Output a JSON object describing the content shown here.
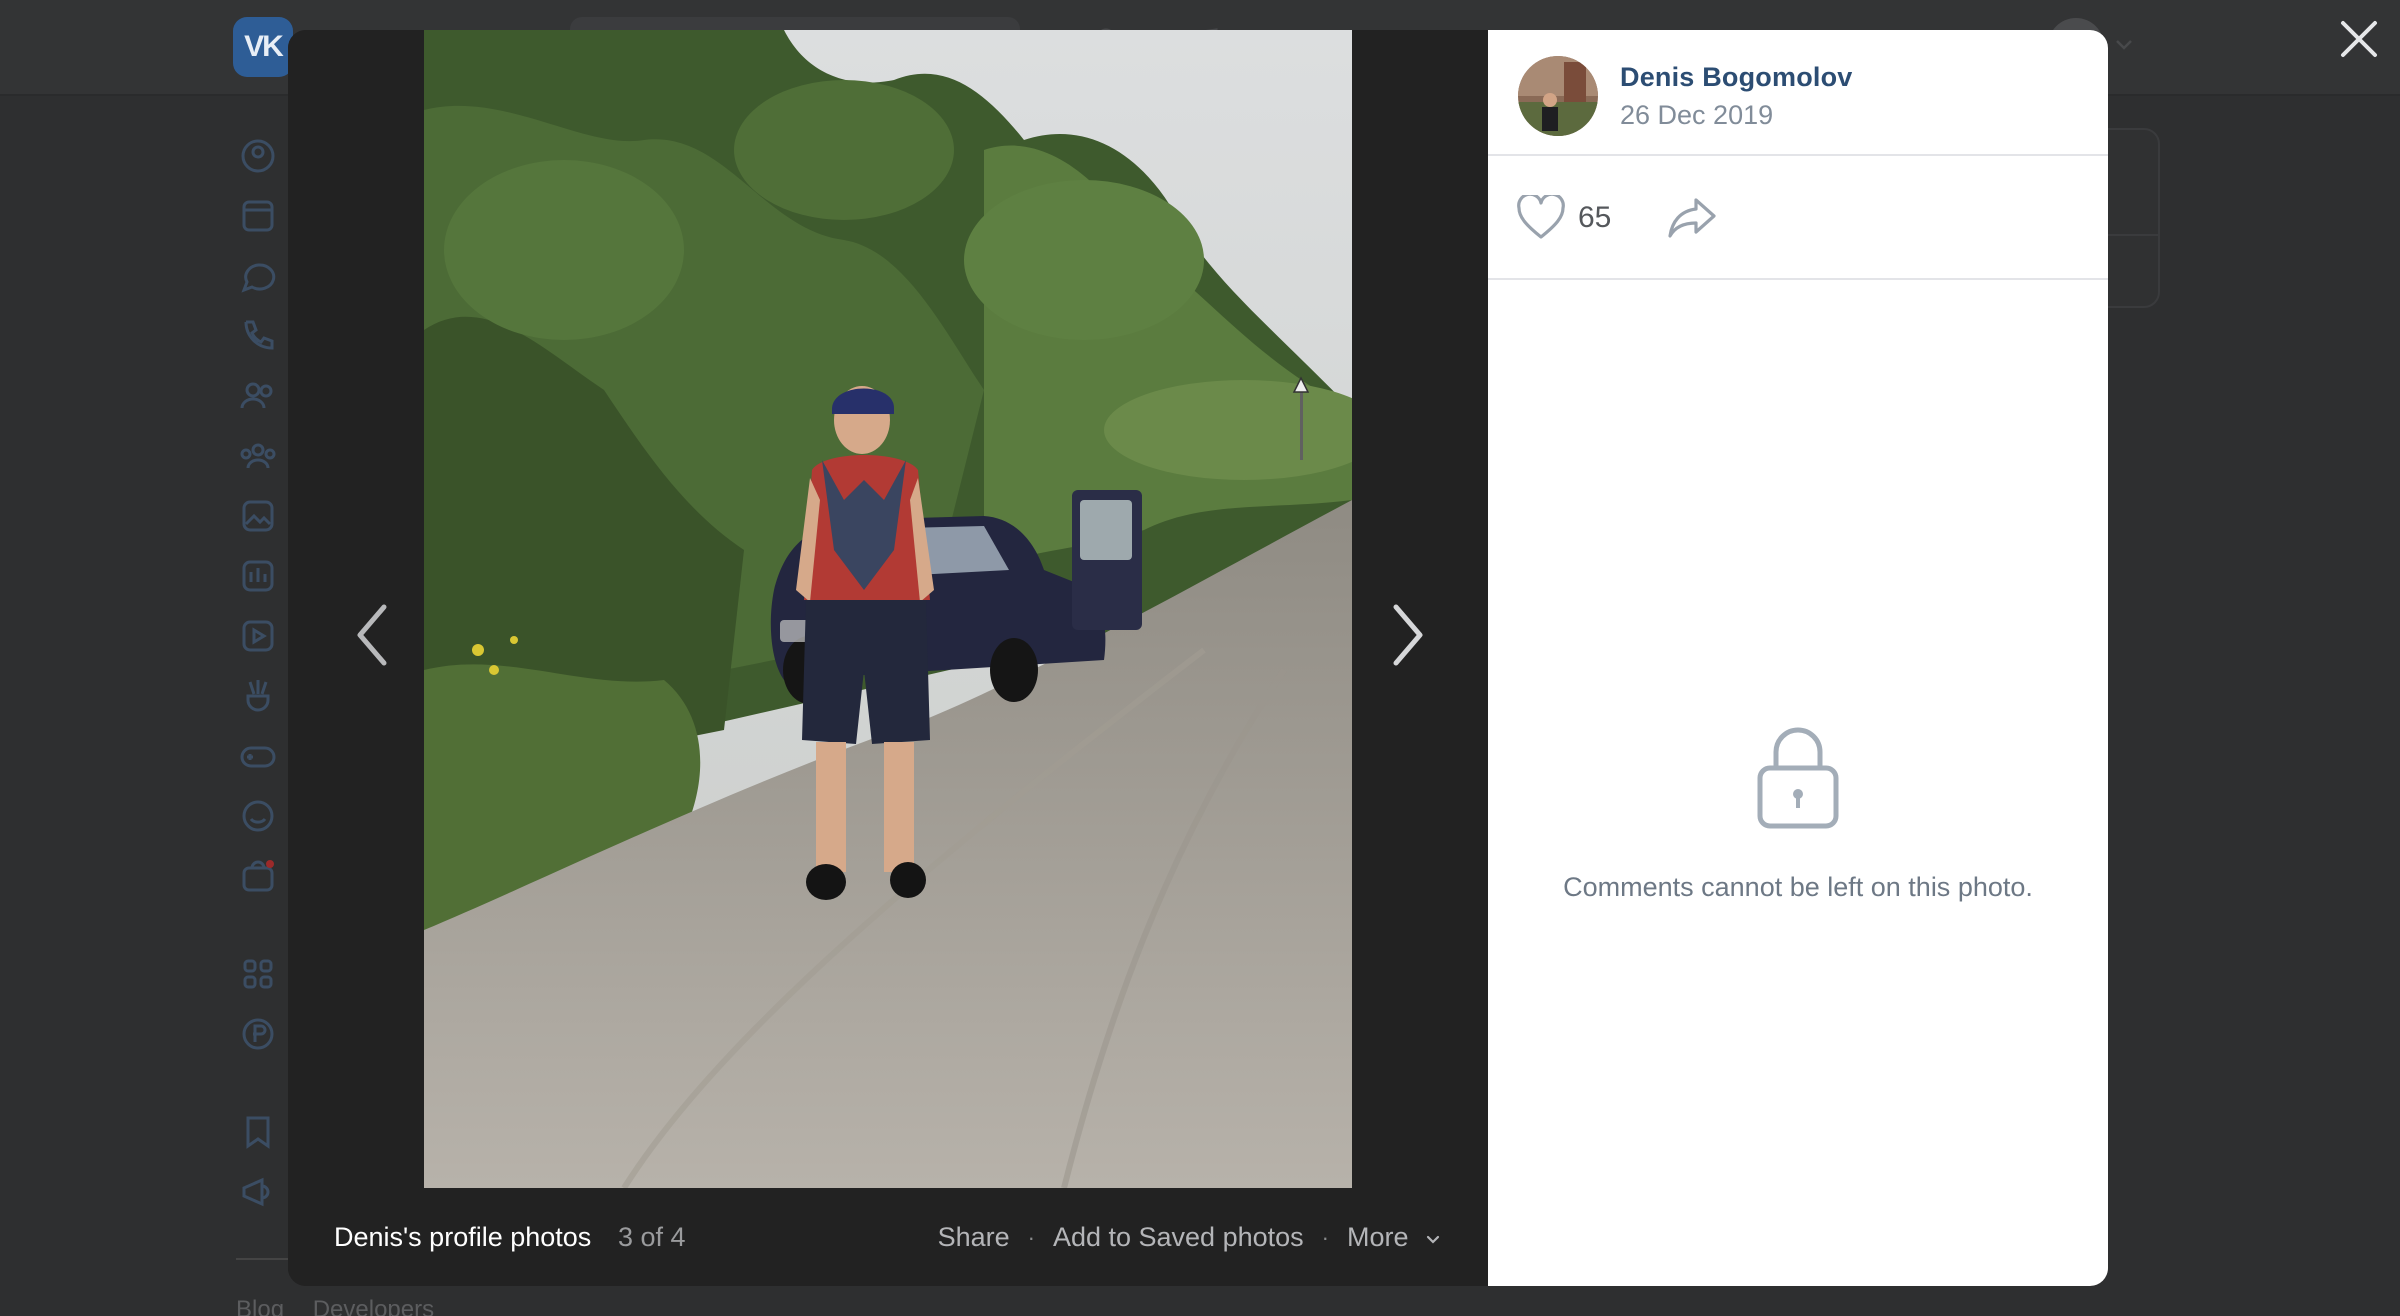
{
  "background_page": {
    "logo_text": "VK",
    "footer_links": [
      "Blog",
      "Developers"
    ]
  },
  "viewer": {
    "album_title": "Denis's profile photos",
    "counter": "3 of 4",
    "actions": {
      "share": "Share",
      "add_saved": "Add to Saved photos",
      "more": "More"
    },
    "photo": {
      "description_icon": "photo-man-on-dirt-road-with-car"
    }
  },
  "side_panel": {
    "author_name": "Denis Bogomolov",
    "date": "26 Dec 2019",
    "likes": "65",
    "comments_locked_text": "Comments cannot be left on this photo."
  },
  "colors": {
    "overlay": "#2e2f30",
    "viewer_bg": "#222222",
    "author_link": "#2c4d73",
    "muted": "#818c99",
    "brand": "#0077ff"
  }
}
